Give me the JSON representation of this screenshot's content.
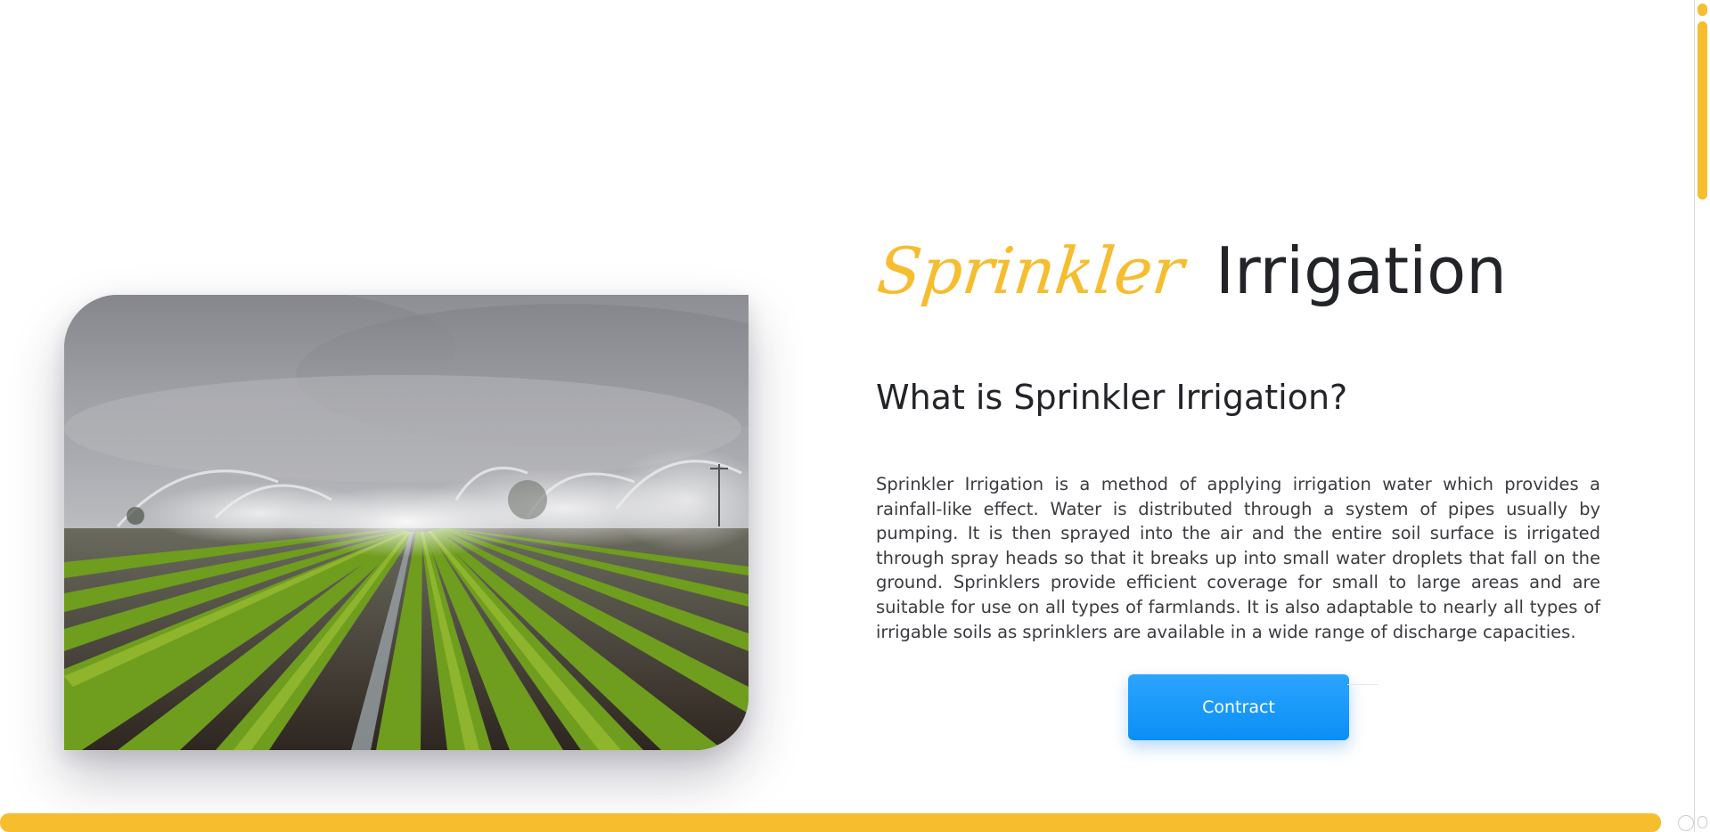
{
  "colors": {
    "accent": "#f6bd2f",
    "heading": "#222428",
    "body_text": "#3a3c40",
    "button": "#0a8ff5",
    "button_text": "#ffffff"
  },
  "hero": {
    "title_accent": "Sprinkler",
    "title_main": "Irrigation",
    "subtitle": "What is Sprinkler Irrigation?",
    "description": "Sprinkler Irrigation is a method of applying irrigation water which provides a rainfall-like effect. Water is distributed through a system of pipes usually by pumping. It is then sprayed into the air and the entire soil surface is irrigated through spray heads so that it breaks up into small water droplets that fall on the ground. Sprinklers provide efficient coverage for small to large areas and are suitable for use on all types of farmlands. It is also adaptable to nearly all types of irrigable soils as sprinklers are available in a wide range of discharge capacities.",
    "button_label": "Contract",
    "image_icon": "field-sprinkler-photo"
  },
  "scroll_progress": {
    "fraction": 0.99
  },
  "scrollbar": {
    "position_fraction": 0.0
  }
}
